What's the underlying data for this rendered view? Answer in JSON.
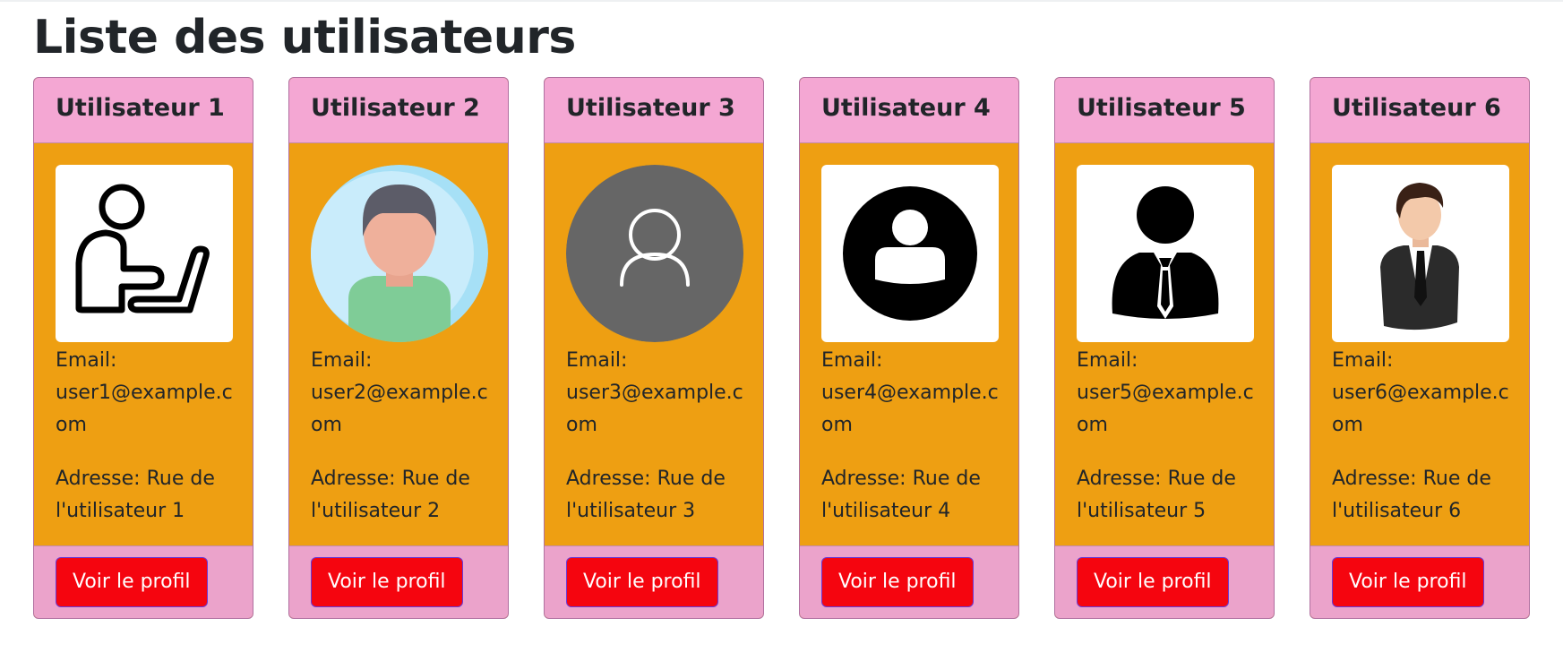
{
  "page": {
    "title": "Liste des utilisateurs"
  },
  "users": [
    {
      "name": "Utilisateur 1",
      "email_label": "Email:",
      "email": "user1@example.com",
      "address": "Adresse: Rue de l'utilisateur 1",
      "button_label": "Voir le profil",
      "avatar_icon": "person-at-laptop-icon"
    },
    {
      "name": "Utilisateur 2",
      "email_label": "Email:",
      "email": "user2@example.com",
      "address": "Adresse: Rue de l'utilisateur 2",
      "button_label": "Voir le profil",
      "avatar_icon": "cartoon-person-avatar-icon"
    },
    {
      "name": "Utilisateur 3",
      "email_label": "Email:",
      "email": "user3@example.com",
      "address": "Adresse: Rue de l'utilisateur 3",
      "button_label": "Voir le profil",
      "avatar_icon": "user-outline-icon"
    },
    {
      "name": "Utilisateur 4",
      "email_label": "Email:",
      "email": "user4@example.com",
      "address": "Adresse: Rue de l'utilisateur 4",
      "button_label": "Voir le profil",
      "avatar_icon": "user-circle-icon"
    },
    {
      "name": "Utilisateur 5",
      "email_label": "Email:",
      "email": "user5@example.com",
      "address": "Adresse: Rue de l'utilisateur 5",
      "button_label": "Voir le profil",
      "avatar_icon": "businessman-tie-icon"
    },
    {
      "name": "Utilisateur 6",
      "email_label": "Email:",
      "email": "user6@example.com",
      "address": "Adresse: Rue de l'utilisateur 6",
      "button_label": "Voir le profil",
      "avatar_icon": "businessman-suit-icon"
    }
  ],
  "colors": {
    "card_header": "#f4a7d3",
    "card_body": "#ee9f12",
    "card_footer": "#eba3cb",
    "button": "#f5050f",
    "button_text": "#ffffff"
  }
}
